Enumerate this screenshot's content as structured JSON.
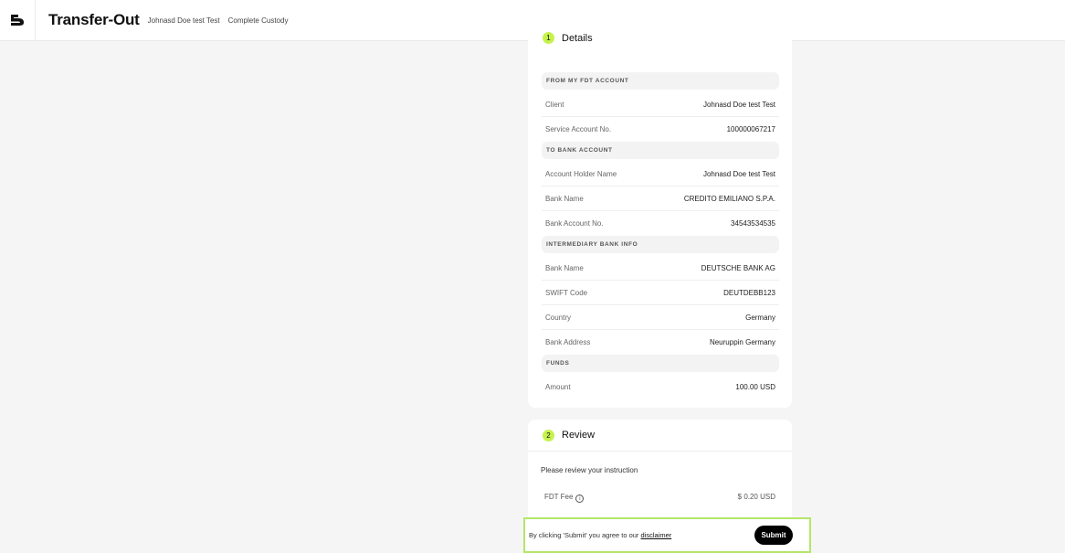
{
  "header": {
    "title": "Transfer-Out",
    "client_name": "Johnasd Doe test Test",
    "account_type": "Complete Custody"
  },
  "details": {
    "step_number": "1",
    "title": "Details",
    "sections": [
      {
        "heading": "FROM MY FDT ACCOUNT",
        "rows": [
          {
            "label": "Client",
            "value": "Johnasd Doe test Test"
          },
          {
            "label": "Service Account No.",
            "value": "100000067217"
          }
        ]
      },
      {
        "heading": "TO BANK ACCOUNT",
        "rows": [
          {
            "label": "Account Holder Name",
            "value": "Johnasd Doe test Test"
          },
          {
            "label": "Bank Name",
            "value": "CREDITO EMILIANO S.P.A."
          },
          {
            "label": "Bank Account No.",
            "value": "34543534535"
          }
        ]
      },
      {
        "heading": "INTERMEDIARY BANK INFO",
        "rows": [
          {
            "label": "Bank Name",
            "value": "DEUTSCHE BANK AG"
          },
          {
            "label": "SWIFT Code",
            "value": "DEUTDEBB123"
          },
          {
            "label": "Country",
            "value": "Germany"
          },
          {
            "label": "Bank Address",
            "value": "Neuruppin Germany"
          }
        ]
      },
      {
        "heading": "FUNDS",
        "rows": [
          {
            "label": "Amount",
            "value": "100.00 USD"
          }
        ]
      }
    ]
  },
  "review": {
    "step_number": "2",
    "title": "Review",
    "message": "Please review your instruction",
    "fee_label": "FDT Fee",
    "fee_value": "$ 0.20 USD"
  },
  "footer": {
    "agree_text": "By clicking 'Submit' you agree to our ",
    "disclaimer_link": "disclaimer",
    "submit_label": "Submit"
  },
  "colors": {
    "accent": "#c6f24e",
    "footer_border": "#b4e66a"
  }
}
